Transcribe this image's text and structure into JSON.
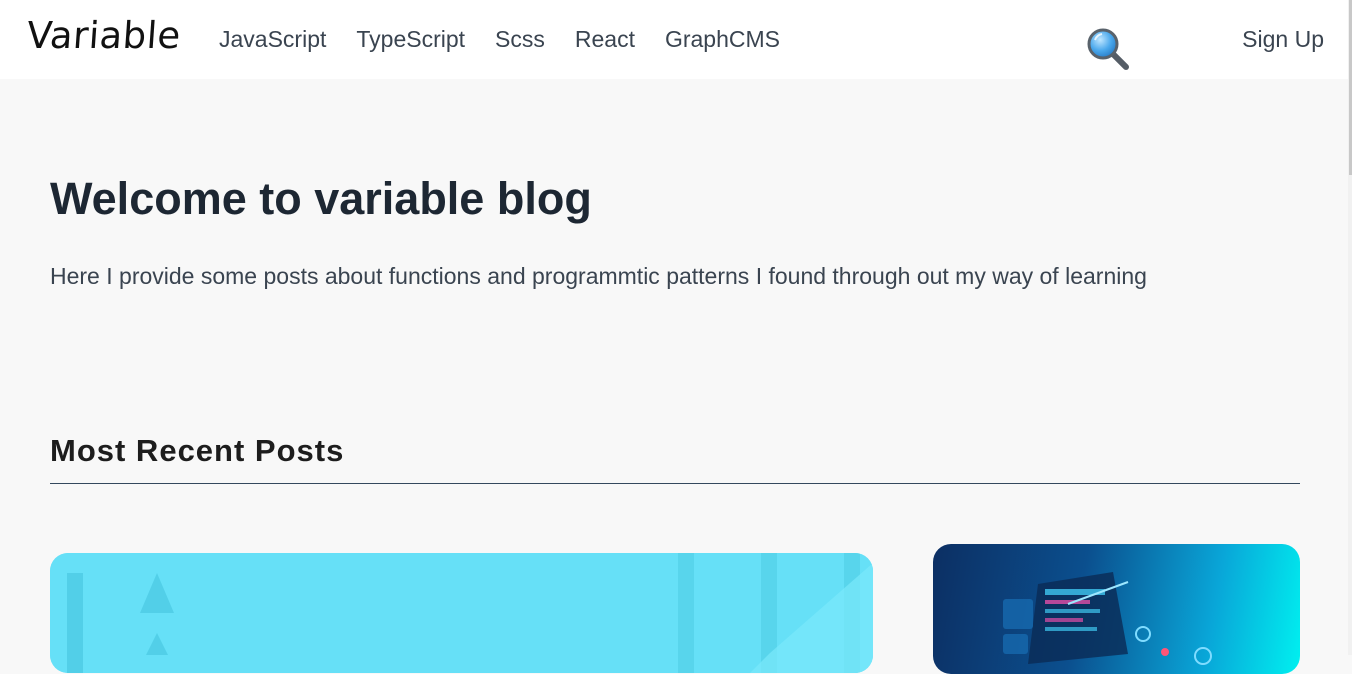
{
  "header": {
    "logo": "Variable",
    "nav": [
      {
        "label": "JavaScript"
      },
      {
        "label": "TypeScript"
      },
      {
        "label": "Scss"
      },
      {
        "label": "React"
      },
      {
        "label": "GraphCMS"
      }
    ],
    "search_icon": "search-icon",
    "signup_label": "Sign Up"
  },
  "hero": {
    "title": "Welcome to variable blog",
    "subtitle": "Here I provide some posts about functions and programmtic patterns I found through out my way of learning"
  },
  "recent": {
    "title": "Most Recent Posts"
  },
  "colors": {
    "accent_cyan": "#66e0f7",
    "text_dark": "#1d2733",
    "divider": "#34495e"
  }
}
